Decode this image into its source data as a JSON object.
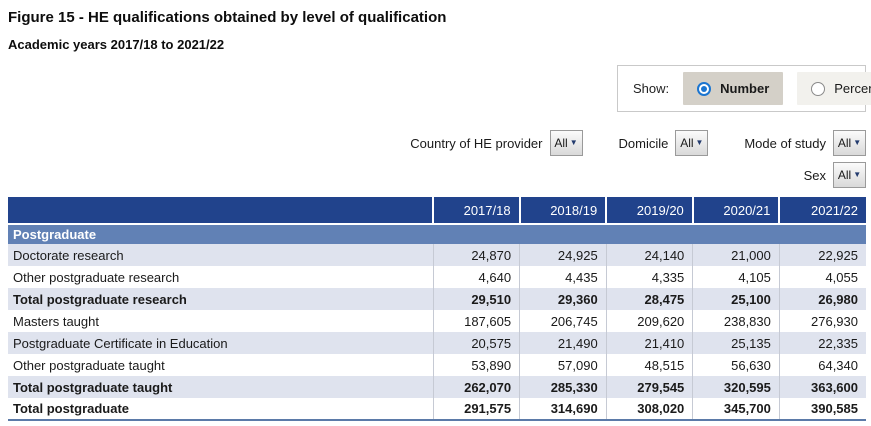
{
  "page": {
    "title": "Figure 15 - HE qualifications obtained by level of qualification",
    "subtitle": "Academic years 2017/18 to 2021/22"
  },
  "show_toggle": {
    "label": "Show:",
    "options": [
      {
        "label": "Number",
        "selected": true
      },
      {
        "label": "Percent",
        "selected": false
      }
    ]
  },
  "filters": [
    {
      "label": "Country of HE provider",
      "value": "All"
    },
    {
      "label": "Domicile",
      "value": "All"
    },
    {
      "label": "Mode of study",
      "value": "All"
    },
    {
      "label": "Sex",
      "value": "All"
    }
  ],
  "icons": {
    "dropdown_caret": "caret-down-icon",
    "radio_selected": "radio-selected-icon",
    "radio_unselected": "radio-unselected-icon"
  },
  "colors": {
    "header_bg": "#21438C",
    "section_bg": "#6181B5",
    "stripe_bg": "#DFE3EE",
    "table_bottom_border": "#5B7AA8",
    "radio_accent": "#1B75D0",
    "selected_chip_bg": "#D4D0C8",
    "unselected_chip_bg": "#F2F1ED"
  },
  "table": {
    "columns": [
      "2017/18",
      "2018/19",
      "2019/20",
      "2020/21",
      "2021/22"
    ],
    "section": "Postgraduate",
    "rows": [
      {
        "label": "Doctorate research",
        "values": [
          "24,870",
          "24,925",
          "24,140",
          "21,000",
          "22,925"
        ],
        "bold": false
      },
      {
        "label": "Other postgraduate research",
        "values": [
          "4,640",
          "4,435",
          "4,335",
          "4,105",
          "4,055"
        ],
        "bold": false
      },
      {
        "label": "Total postgraduate research",
        "values": [
          "29,510",
          "29,360",
          "28,475",
          "25,100",
          "26,980"
        ],
        "bold": true
      },
      {
        "label": "Masters taught",
        "values": [
          "187,605",
          "206,745",
          "209,620",
          "238,830",
          "276,930"
        ],
        "bold": false
      },
      {
        "label": "Postgraduate Certificate in Education",
        "values": [
          "20,575",
          "21,490",
          "21,410",
          "25,135",
          "22,335"
        ],
        "bold": false
      },
      {
        "label": "Other postgraduate taught",
        "values": [
          "53,890",
          "57,090",
          "48,515",
          "56,630",
          "64,340"
        ],
        "bold": false
      },
      {
        "label": "Total postgraduate taught",
        "values": [
          "262,070",
          "285,330",
          "279,545",
          "320,595",
          "363,600"
        ],
        "bold": true
      },
      {
        "label": "Total postgraduate",
        "values": [
          "291,575",
          "314,690",
          "308,020",
          "345,700",
          "390,585"
        ],
        "bold": true
      }
    ]
  }
}
